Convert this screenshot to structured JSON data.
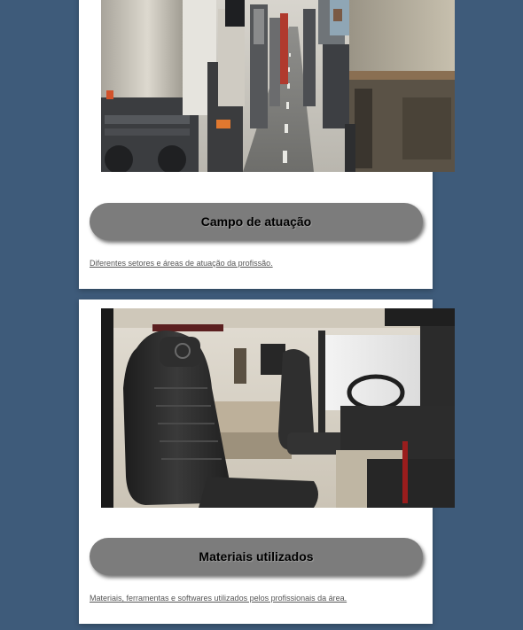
{
  "cards": [
    {
      "button_label": "Campo de atuação",
      "description": "Diferentes setores e áreas de atuação da profissão."
    },
    {
      "button_label": "Materiais utilizados",
      "description": "Materiais, ferramentas e softwares utilizados pelos profissionais da área."
    }
  ],
  "colors": {
    "background": "#3e5b7a",
    "card": "#ffffff",
    "button": "#7c7c7c",
    "link": "#555555"
  }
}
